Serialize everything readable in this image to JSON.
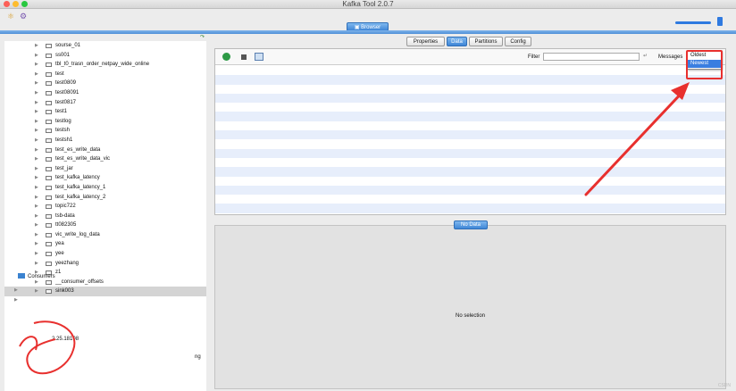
{
  "window": {
    "title": "Kafka Tool  2.0.7"
  },
  "toolbar": {
    "browser_tab": "Browser"
  },
  "tree": {
    "topics": [
      "sourse_01",
      "ss001",
      "tbl_t0_trasn_order_netpay_wide_online",
      "test",
      "test0809",
      "test08091",
      "test0817",
      "test1",
      "testlog",
      "testsh",
      "testsh1",
      "test_es_write_data",
      "test_es_write_data_vic",
      "test_jar",
      "test_kafka_latency",
      "test_kafka_latency_1",
      "test_kafka_latency_2",
      "topic722",
      "tsb-data",
      "tt082305",
      "vic_write_log_data",
      "yea",
      "yee",
      "yeezhang",
      "z1",
      "__consumer_offsets",
      "sink003"
    ],
    "selected": "sink003",
    "consumers_label": "Consumers",
    "partial_labels": [
      "2.25.18108",
      "ng"
    ]
  },
  "tabs": [
    "Properties",
    "Data",
    "Partitions",
    "Config"
  ],
  "active_tab": "Data",
  "data_toolbar": {
    "filter_label": "Filter",
    "filter_value": "",
    "messages_label": "Messages",
    "messages_options": [
      "Oldest",
      "Newest"
    ],
    "messages_highlighted": "Newest"
  },
  "status": {
    "no_data_label": "No Data",
    "no_selection": "No selection"
  },
  "colors": {
    "accent": "#3f86d6",
    "annotation": "#e8302e",
    "row_alt": "#e7eefb"
  }
}
